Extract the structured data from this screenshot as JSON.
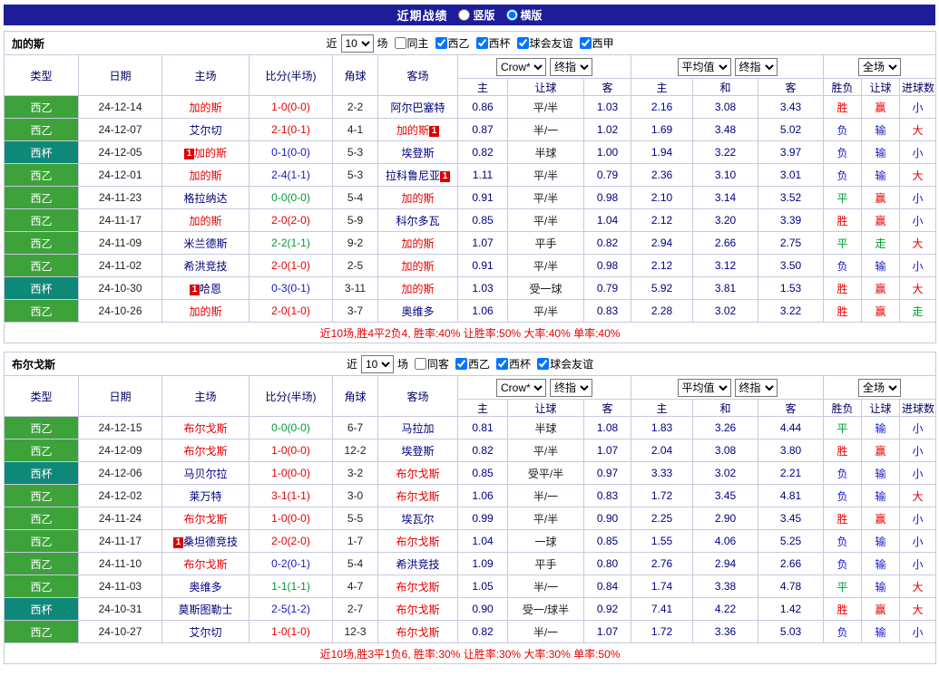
{
  "titlebar": {
    "title": "近期战绩",
    "layout_options": [
      {
        "label": "竖版",
        "selected": false
      },
      {
        "label": "横版",
        "selected": true
      }
    ]
  },
  "filter": {
    "near_label": "近",
    "count_value": "10",
    "games_label": "场"
  },
  "table_header": {
    "static_columns": [
      "类型",
      "日期",
      "主场",
      "比分(半场)",
      "角球",
      "客场"
    ],
    "odds_groups": [
      {
        "dropdowns": [
          "Crow*",
          "终指"
        ],
        "sub_columns": [
          "主",
          "让球",
          "客"
        ]
      },
      {
        "dropdowns": [
          "平均值",
          "终指"
        ],
        "sub_columns": [
          "主",
          "和",
          "客"
        ]
      },
      {
        "dropdowns": [
          "全场"
        ],
        "sub_columns": [
          "胜负",
          "让球",
          "进球数"
        ]
      }
    ]
  },
  "colors": {
    "titlebar_bg": "#1d1d9a",
    "league": {
      "西乙": "#3da23a",
      "西杯": "#0e8878"
    },
    "result": {
      "red": "#e60000",
      "green": "#009933",
      "blue": "#1717cc"
    },
    "focus_team": "#e60000",
    "other_team": "#000080",
    "odds_number": "#000080",
    "handicap_text": "#1a1a1a",
    "summary_text": "#e60000"
  },
  "sections": [
    {
      "team": "加的斯",
      "filters": [
        {
          "label": "同主",
          "checked": false
        },
        {
          "label": "西乙",
          "checked": true
        },
        {
          "label": "西杯",
          "checked": true
        },
        {
          "label": "球会友谊",
          "checked": true
        },
        {
          "label": "西甲",
          "checked": true
        }
      ],
      "rows": [
        {
          "league": "西乙",
          "date": "24-12-14",
          "home": {
            "name": "加的斯",
            "focus": true
          },
          "score": {
            "text": "1-0(0-0)",
            "color": "red"
          },
          "corners": "2-2",
          "away": {
            "name": "阿尔巴塞特",
            "focus": false
          },
          "odds": [
            "0.86",
            "平/半",
            "1.03"
          ],
          "avg": [
            "2.16",
            "3.08",
            "3.43"
          ],
          "results": [
            [
              "胜",
              "red"
            ],
            [
              "赢",
              "red"
            ],
            [
              "小",
              "blue"
            ]
          ]
        },
        {
          "league": "西乙",
          "date": "24-12-07",
          "home": {
            "name": "艾尔切",
            "focus": false
          },
          "score": {
            "text": "2-1(0-1)",
            "color": "red"
          },
          "corners": "4-1",
          "away": {
            "name": "加的斯",
            "focus": true,
            "badge": {
              "text": "1",
              "pos": "after"
            }
          },
          "odds": [
            "0.87",
            "半/一",
            "1.02"
          ],
          "avg": [
            "1.69",
            "3.48",
            "5.02"
          ],
          "results": [
            [
              "负",
              "blue"
            ],
            [
              "输",
              "blue"
            ],
            [
              "大",
              "red"
            ]
          ]
        },
        {
          "league": "西杯",
          "date": "24-12-05",
          "home": {
            "name": "加的斯",
            "focus": true,
            "badge": {
              "text": "1",
              "pos": "before"
            }
          },
          "score": {
            "text": "0-1(0-0)",
            "color": "blue"
          },
          "corners": "5-3",
          "away": {
            "name": "埃登斯",
            "focus": false
          },
          "odds": [
            "0.82",
            "半球",
            "1.00"
          ],
          "avg": [
            "1.94",
            "3.22",
            "3.97"
          ],
          "results": [
            [
              "负",
              "blue"
            ],
            [
              "输",
              "blue"
            ],
            [
              "小",
              "blue"
            ]
          ]
        },
        {
          "league": "西乙",
          "date": "24-12-01",
          "home": {
            "name": "加的斯",
            "focus": true
          },
          "score": {
            "text": "2-4(1-1)",
            "color": "blue"
          },
          "corners": "5-3",
          "away": {
            "name": "拉科鲁尼亚",
            "focus": false,
            "badge": {
              "text": "1",
              "pos": "after"
            }
          },
          "odds": [
            "1.11",
            "平/半",
            "0.79"
          ],
          "avg": [
            "2.36",
            "3.10",
            "3.01"
          ],
          "results": [
            [
              "负",
              "blue"
            ],
            [
              "输",
              "blue"
            ],
            [
              "大",
              "red"
            ]
          ]
        },
        {
          "league": "西乙",
          "date": "24-11-23",
          "home": {
            "name": "格拉纳达",
            "focus": false
          },
          "score": {
            "text": "0-0(0-0)",
            "color": "green"
          },
          "corners": "5-4",
          "away": {
            "name": "加的斯",
            "focus": true
          },
          "odds": [
            "0.91",
            "平/半",
            "0.98"
          ],
          "avg": [
            "2.10",
            "3.14",
            "3.52"
          ],
          "results": [
            [
              "平",
              "green"
            ],
            [
              "赢",
              "red"
            ],
            [
              "小",
              "blue"
            ]
          ]
        },
        {
          "league": "西乙",
          "date": "24-11-17",
          "home": {
            "name": "加的斯",
            "focus": true
          },
          "score": {
            "text": "2-0(2-0)",
            "color": "red"
          },
          "corners": "5-9",
          "away": {
            "name": "科尔多瓦",
            "focus": false
          },
          "odds": [
            "0.85",
            "平/半",
            "1.04"
          ],
          "avg": [
            "2.12",
            "3.20",
            "3.39"
          ],
          "results": [
            [
              "胜",
              "red"
            ],
            [
              "赢",
              "red"
            ],
            [
              "小",
              "blue"
            ]
          ]
        },
        {
          "league": "西乙",
          "date": "24-11-09",
          "home": {
            "name": "米兰德斯",
            "focus": false
          },
          "score": {
            "text": "2-2(1-1)",
            "color": "green"
          },
          "corners": "9-2",
          "away": {
            "name": "加的斯",
            "focus": true
          },
          "odds": [
            "1.07",
            "平手",
            "0.82"
          ],
          "avg": [
            "2.94",
            "2.66",
            "2.75"
          ],
          "results": [
            [
              "平",
              "green"
            ],
            [
              "走",
              "green"
            ],
            [
              "大",
              "red"
            ]
          ]
        },
        {
          "league": "西乙",
          "date": "24-11-02",
          "home": {
            "name": "希洪竞技",
            "focus": false
          },
          "score": {
            "text": "2-0(1-0)",
            "color": "red"
          },
          "corners": "2-5",
          "away": {
            "name": "加的斯",
            "focus": true
          },
          "odds": [
            "0.91",
            "平/半",
            "0.98"
          ],
          "avg": [
            "2.12",
            "3.12",
            "3.50"
          ],
          "results": [
            [
              "负",
              "blue"
            ],
            [
              "输",
              "blue"
            ],
            [
              "小",
              "blue"
            ]
          ]
        },
        {
          "league": "西杯",
          "date": "24-10-30",
          "home": {
            "name": "哈恩",
            "focus": false,
            "badge": {
              "text": "1",
              "pos": "before"
            }
          },
          "score": {
            "text": "0-3(0-1)",
            "color": "blue"
          },
          "corners": "3-11",
          "away": {
            "name": "加的斯",
            "focus": true
          },
          "odds": [
            "1.03",
            "受一球",
            "0.79"
          ],
          "avg": [
            "5.92",
            "3.81",
            "1.53"
          ],
          "results": [
            [
              "胜",
              "red"
            ],
            [
              "赢",
              "red"
            ],
            [
              "大",
              "red"
            ]
          ]
        },
        {
          "league": "西乙",
          "date": "24-10-26",
          "home": {
            "name": "加的斯",
            "focus": true
          },
          "score": {
            "text": "2-0(1-0)",
            "color": "red"
          },
          "corners": "3-7",
          "away": {
            "name": "奥维多",
            "focus": false
          },
          "odds": [
            "1.06",
            "平/半",
            "0.83"
          ],
          "avg": [
            "2.28",
            "3.02",
            "3.22"
          ],
          "results": [
            [
              "胜",
              "red"
            ],
            [
              "赢",
              "red"
            ],
            [
              "走",
              "green"
            ]
          ]
        }
      ],
      "summary": "近10场,胜4平2负4, 胜率:40% 让胜率:50% 大率:40% 单率:40%"
    },
    {
      "team": "布尔戈斯",
      "filters": [
        {
          "label": "同客",
          "checked": false
        },
        {
          "label": "西乙",
          "checked": true
        },
        {
          "label": "西杯",
          "checked": true
        },
        {
          "label": "球会友谊",
          "checked": true
        }
      ],
      "rows": [
        {
          "league": "西乙",
          "date": "24-12-15",
          "home": {
            "name": "布尔戈斯",
            "focus": true
          },
          "score": {
            "text": "0-0(0-0)",
            "color": "green"
          },
          "corners": "6-7",
          "away": {
            "name": "马拉加",
            "focus": false
          },
          "odds": [
            "0.81",
            "半球",
            "1.08"
          ],
          "avg": [
            "1.83",
            "3.26",
            "4.44"
          ],
          "results": [
            [
              "平",
              "green"
            ],
            [
              "输",
              "blue"
            ],
            [
              "小",
              "blue"
            ]
          ]
        },
        {
          "league": "西乙",
          "date": "24-12-09",
          "home": {
            "name": "布尔戈斯",
            "focus": true
          },
          "score": {
            "text": "1-0(0-0)",
            "color": "red"
          },
          "corners": "12-2",
          "away": {
            "name": "埃登斯",
            "focus": false
          },
          "odds": [
            "0.82",
            "平/半",
            "1.07"
          ],
          "avg": [
            "2.04",
            "3.08",
            "3.80"
          ],
          "results": [
            [
              "胜",
              "red"
            ],
            [
              "赢",
              "red"
            ],
            [
              "小",
              "blue"
            ]
          ]
        },
        {
          "league": "西杯",
          "date": "24-12-06",
          "home": {
            "name": "马贝尔拉",
            "focus": false
          },
          "score": {
            "text": "1-0(0-0)",
            "color": "red"
          },
          "corners": "3-2",
          "away": {
            "name": "布尔戈斯",
            "focus": true
          },
          "odds": [
            "0.85",
            "受平/半",
            "0.97"
          ],
          "avg": [
            "3.33",
            "3.02",
            "2.21"
          ],
          "results": [
            [
              "负",
              "blue"
            ],
            [
              "输",
              "blue"
            ],
            [
              "小",
              "blue"
            ]
          ]
        },
        {
          "league": "西乙",
          "date": "24-12-02",
          "home": {
            "name": "莱万特",
            "focus": false
          },
          "score": {
            "text": "3-1(1-1)",
            "color": "red"
          },
          "corners": "3-0",
          "away": {
            "name": "布尔戈斯",
            "focus": true
          },
          "odds": [
            "1.06",
            "半/一",
            "0.83"
          ],
          "avg": [
            "1.72",
            "3.45",
            "4.81"
          ],
          "results": [
            [
              "负",
              "blue"
            ],
            [
              "输",
              "blue"
            ],
            [
              "大",
              "red"
            ]
          ]
        },
        {
          "league": "西乙",
          "date": "24-11-24",
          "home": {
            "name": "布尔戈斯",
            "focus": true
          },
          "score": {
            "text": "1-0(0-0)",
            "color": "red"
          },
          "corners": "5-5",
          "away": {
            "name": "埃瓦尔",
            "focus": false
          },
          "odds": [
            "0.99",
            "平/半",
            "0.90"
          ],
          "avg": [
            "2.25",
            "2.90",
            "3.45"
          ],
          "results": [
            [
              "胜",
              "red"
            ],
            [
              "赢",
              "red"
            ],
            [
              "小",
              "blue"
            ]
          ]
        },
        {
          "league": "西乙",
          "date": "24-11-17",
          "home": {
            "name": "桑坦德竞技",
            "focus": false,
            "badge": {
              "text": "1",
              "pos": "before"
            }
          },
          "score": {
            "text": "2-0(2-0)",
            "color": "red"
          },
          "corners": "1-7",
          "away": {
            "name": "布尔戈斯",
            "focus": true
          },
          "odds": [
            "1.04",
            "一球",
            "0.85"
          ],
          "avg": [
            "1.55",
            "4.06",
            "5.25"
          ],
          "results": [
            [
              "负",
              "blue"
            ],
            [
              "输",
              "blue"
            ],
            [
              "小",
              "blue"
            ]
          ]
        },
        {
          "league": "西乙",
          "date": "24-11-10",
          "home": {
            "name": "布尔戈斯",
            "focus": true
          },
          "score": {
            "text": "0-2(0-1)",
            "color": "blue"
          },
          "corners": "5-4",
          "away": {
            "name": "希洪竞技",
            "focus": false
          },
          "odds": [
            "1.09",
            "平手",
            "0.80"
          ],
          "avg": [
            "2.76",
            "2.94",
            "2.66"
          ],
          "results": [
            [
              "负",
              "blue"
            ],
            [
              "输",
              "blue"
            ],
            [
              "小",
              "blue"
            ]
          ]
        },
        {
          "league": "西乙",
          "date": "24-11-03",
          "home": {
            "name": "奥维多",
            "focus": false
          },
          "score": {
            "text": "1-1(1-1)",
            "color": "green"
          },
          "corners": "4-7",
          "away": {
            "name": "布尔戈斯",
            "focus": true
          },
          "odds": [
            "1.05",
            "半/一",
            "0.84"
          ],
          "avg": [
            "1.74",
            "3.38",
            "4.78"
          ],
          "results": [
            [
              "平",
              "green"
            ],
            [
              "输",
              "blue"
            ],
            [
              "大",
              "red"
            ]
          ]
        },
        {
          "league": "西杯",
          "date": "24-10-31",
          "home": {
            "name": "莫斯图勒士",
            "focus": false
          },
          "score": {
            "text": "2-5(1-2)",
            "color": "blue"
          },
          "corners": "2-7",
          "away": {
            "name": "布尔戈斯",
            "focus": true
          },
          "odds": [
            "0.90",
            "受一/球半",
            "0.92"
          ],
          "avg": [
            "7.41",
            "4.22",
            "1.42"
          ],
          "results": [
            [
              "胜",
              "red"
            ],
            [
              "赢",
              "red"
            ],
            [
              "大",
              "red"
            ]
          ]
        },
        {
          "league": "西乙",
          "date": "24-10-27",
          "home": {
            "name": "艾尔切",
            "focus": false
          },
          "score": {
            "text": "1-0(1-0)",
            "color": "red"
          },
          "corners": "12-3",
          "away": {
            "name": "布尔戈斯",
            "focus": true
          },
          "odds": [
            "0.82",
            "半/一",
            "1.07"
          ],
          "avg": [
            "1.72",
            "3.36",
            "5.03"
          ],
          "results": [
            [
              "负",
              "blue"
            ],
            [
              "输",
              "blue"
            ],
            [
              "小",
              "blue"
            ]
          ]
        }
      ],
      "summary": "近10场,胜3平1负6, 胜率:30% 让胜率:30% 大率:30% 单率:50%"
    }
  ]
}
